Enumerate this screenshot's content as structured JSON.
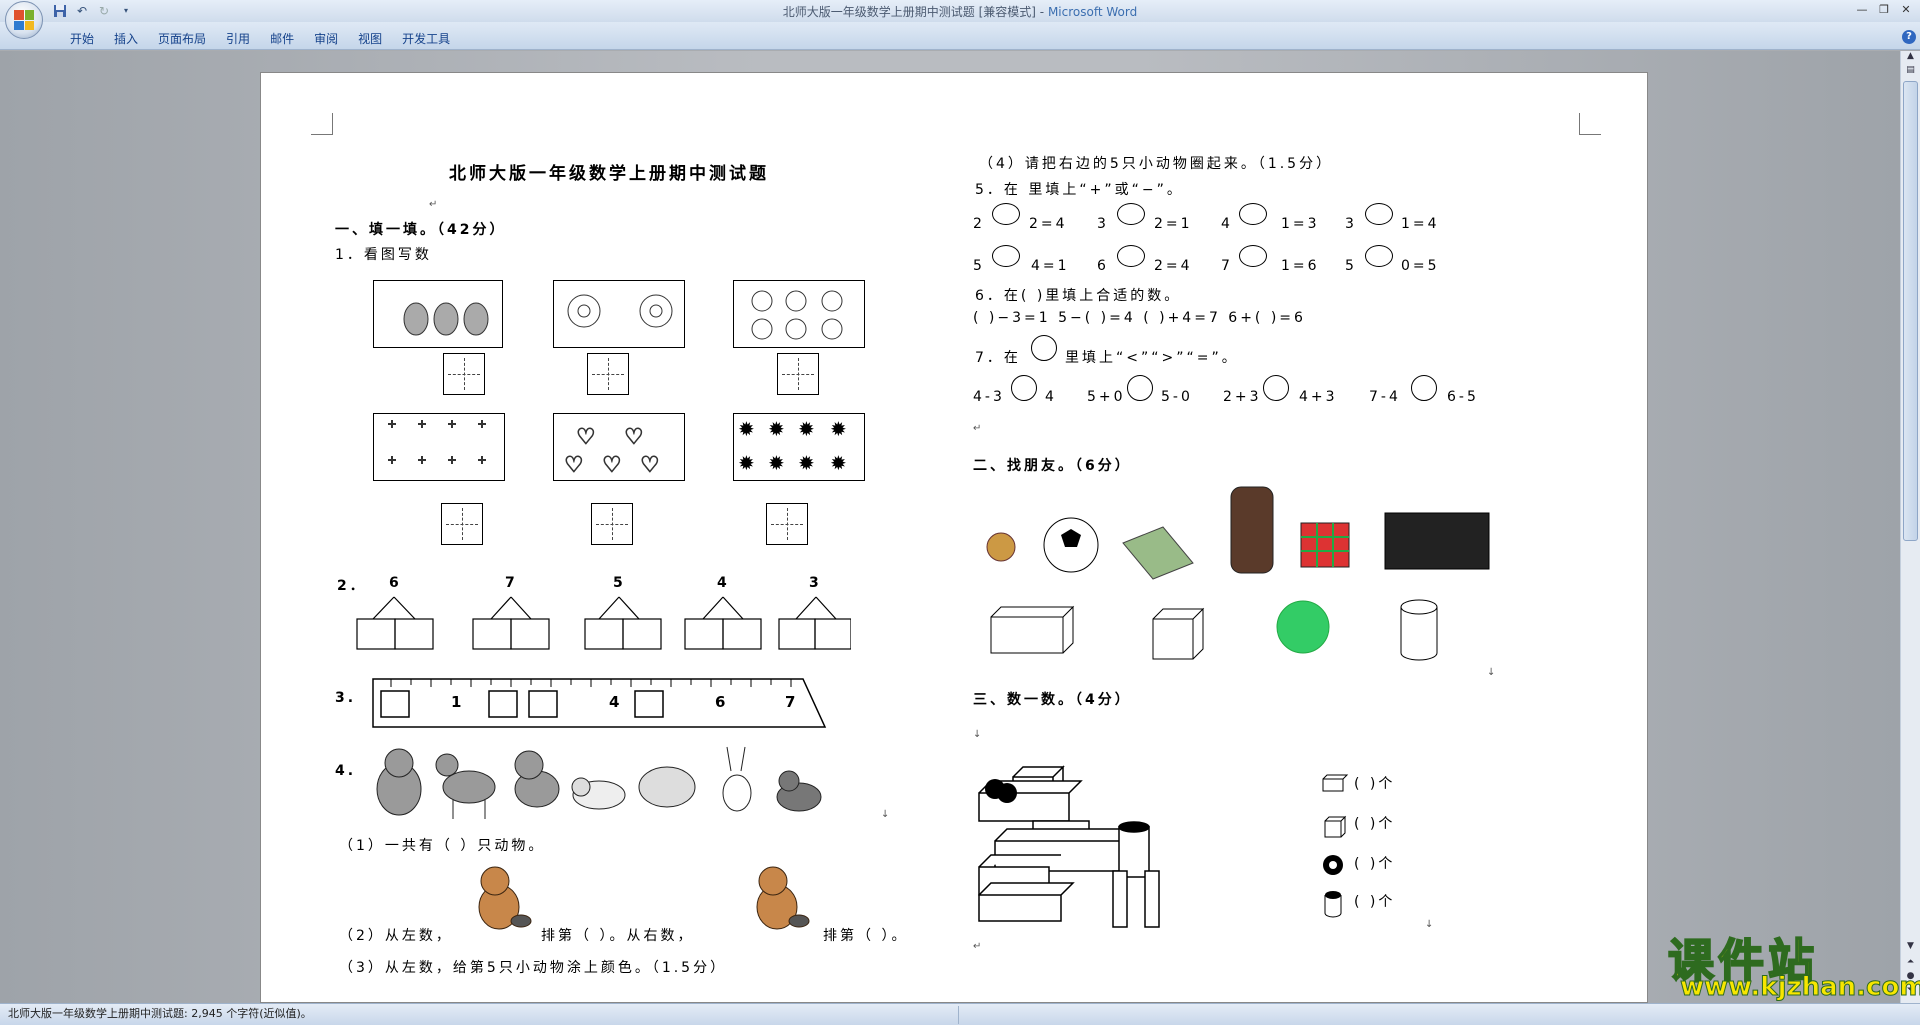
{
  "window": {
    "title": "北师大版一年级数学上册期中测试题 [兼容模式]",
    "separator": " - ",
    "app": "Microsoft Word"
  },
  "ribbon": {
    "tabs": [
      "开始",
      "插入",
      "页面布局",
      "引用",
      "邮件",
      "审阅",
      "视图",
      "开发工具"
    ]
  },
  "status": {
    "text": "北师大版一年级数学上册期中测试题: 2,945 个字符(近似值)。"
  },
  "watermark": {
    "name": "课件站",
    "url": "www.kjzhan.com"
  },
  "doc": {
    "title": "北师大版一年级数学上册期中测试题",
    "sec1": "一、填一填。（42分）",
    "q1": "1．看图写数",
    "q2": "2．",
    "q2_nums": [
      "6",
      "7",
      "5",
      "4",
      "3"
    ],
    "q3": "3.",
    "ruler_nums": [
      "1",
      "4",
      "6",
      "7"
    ],
    "q4": "4.",
    "q4_1": "（1）一共有（    ）只动物。",
    "q4_2a": "（2）从左数，",
    "q4_2b": "排第（    ）。从右数，",
    "q4_2c": "排第（    ）。",
    "q4_3": "（3）从左数，给第5只小动物涂上颜色。（1.5分）",
    "q4_4": "（4）请把右边的5只小动物圈起来。（1.5分）",
    "q5": "5．在     里填上“+”或“−”。",
    "q5_row1": [
      "2",
      "2=4",
      "3",
      "2=1",
      "4",
      "1=3",
      "3",
      "1=4"
    ],
    "q5_row2": [
      "5",
      "4=1",
      "6",
      "2=4",
      "7",
      "1=6",
      "5",
      "0=5"
    ],
    "q6": "6．在(   )里填上合适的数。",
    "q6_row": "(   )−3=1     5−(   )=4     (   )+4=7    6+(   )=6",
    "q7_a": "7．在",
    "q7_b": "里填上“<”“>”“=”。",
    "q7_row": [
      "4-3",
      "4",
      "5+0",
      "5-0",
      "2+3",
      "4+3",
      "7-4",
      "6-5"
    ],
    "sec2": "二、找朋友。（6分）",
    "sec3": "三、数一数。（4分）",
    "count_rows": [
      "(         )个",
      "(         )个",
      "(         )个",
      "(         )个"
    ]
  }
}
